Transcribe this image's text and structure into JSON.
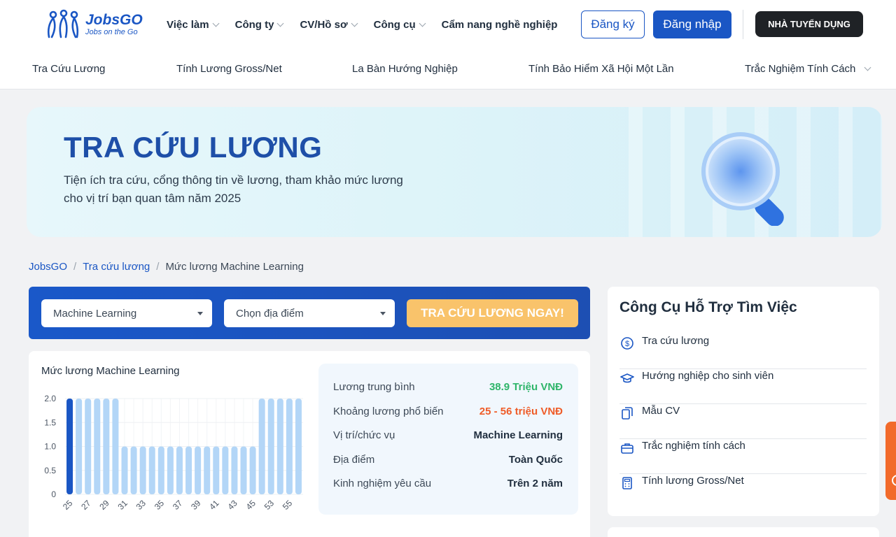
{
  "header": {
    "logo": {
      "name": "JobsGO",
      "tagline": "Jobs on the Go"
    },
    "nav": [
      {
        "label": "Việc làm",
        "has_dropdown": true
      },
      {
        "label": "Công ty",
        "has_dropdown": true
      },
      {
        "label": "CV/Hồ sơ",
        "has_dropdown": true
      },
      {
        "label": "Công cụ",
        "has_dropdown": true
      },
      {
        "label": "Cẩm nang nghề nghiệp",
        "has_dropdown": false
      }
    ],
    "register_label": "Đăng ký",
    "login_label": "Đăng nhập",
    "employer_label": "NHÀ TUYỂN DỤNG"
  },
  "subnav": [
    {
      "label": "Tra Cứu Lương"
    },
    {
      "label": "Tính Lương Gross/Net"
    },
    {
      "label": "La Bàn Hướng Nghiệp"
    },
    {
      "label": "Tính Bảo Hiểm Xã Hội Một Lần"
    },
    {
      "label": "Trắc Nghiệm Tính Cách",
      "has_dropdown": true
    }
  ],
  "banner": {
    "title": "TRA CỨU LƯƠNG",
    "desc_line1": "Tiện ích tra cứu, cổng thông tin về lương, tham khảo mức lương",
    "desc_line2": "cho vị trí bạn quan tâm năm 2025"
  },
  "breadcrumb": {
    "home": "JobsGO",
    "section": "Tra cứu lương",
    "current": "Mức lương Machine Learning",
    "separator": "/"
  },
  "search": {
    "job_value": "Machine Learning",
    "location_placeholder": "Chọn địa điểm",
    "button_label": "TRA CỨU LƯƠNG NGAY!"
  },
  "chart_data": {
    "type": "bar",
    "title": "Mức lương Machine Learning",
    "categories": [
      25,
      26,
      27,
      28,
      29,
      30,
      31,
      32,
      33,
      34,
      35,
      36,
      37,
      38,
      39,
      40,
      41,
      42,
      43,
      44,
      45,
      53,
      54,
      55,
      56
    ],
    "values": [
      2,
      2,
      2,
      2,
      2,
      2,
      1,
      1,
      1,
      1,
      1,
      1,
      1,
      1,
      1,
      1,
      1,
      1,
      1,
      1,
      1,
      2,
      2,
      2,
      2,
      2
    ],
    "x_tick_labels": [
      "25",
      "27",
      "29",
      "31",
      "33",
      "35",
      "37",
      "39",
      "41",
      "43",
      "45",
      "53",
      "55"
    ],
    "y_ticks": [
      "0",
      "0.5",
      "1.0",
      "1.5",
      "2.0"
    ],
    "ylim": [
      0,
      2
    ],
    "highlight_index": 0,
    "colors": {
      "highlight": "#1a56c4",
      "normal": "#b3d6f7"
    }
  },
  "stats": [
    {
      "label": "Lương trung bình",
      "value": "38.9 Triệu VNĐ",
      "tone": "green"
    },
    {
      "label": "Khoảng lương phổ biến",
      "value": "25 - 56 triệu VNĐ",
      "tone": "orange"
    },
    {
      "label": "Vị trí/chức vụ",
      "value": "Machine Learning",
      "tone": "default"
    },
    {
      "label": "Địa điểm",
      "value": "Toàn Quốc",
      "tone": "default"
    },
    {
      "label": "Kinh nghiệm yêu cầu",
      "value": "Trên 2 năm",
      "tone": "default"
    }
  ],
  "sidebar": {
    "title": "Công Cụ Hỗ Trợ Tìm Việc",
    "items": [
      {
        "label": "Tra cứu lương",
        "icon": "dollar-circle-icon"
      },
      {
        "label": "Hướng nghiệp cho sinh viên",
        "icon": "graduation-cap-icon"
      },
      {
        "label": "Mẫu CV",
        "icon": "document-copy-icon"
      },
      {
        "label": "Trắc nghiệm tính cách",
        "icon": "briefcase-icon"
      },
      {
        "label": "Tính lương Gross/Net",
        "icon": "calculator-icon"
      }
    ]
  },
  "colors": {
    "brand": "#1a56c4",
    "accent_button": "#f9c36b",
    "green": "#2fb56a",
    "orange": "#ef5c28"
  }
}
